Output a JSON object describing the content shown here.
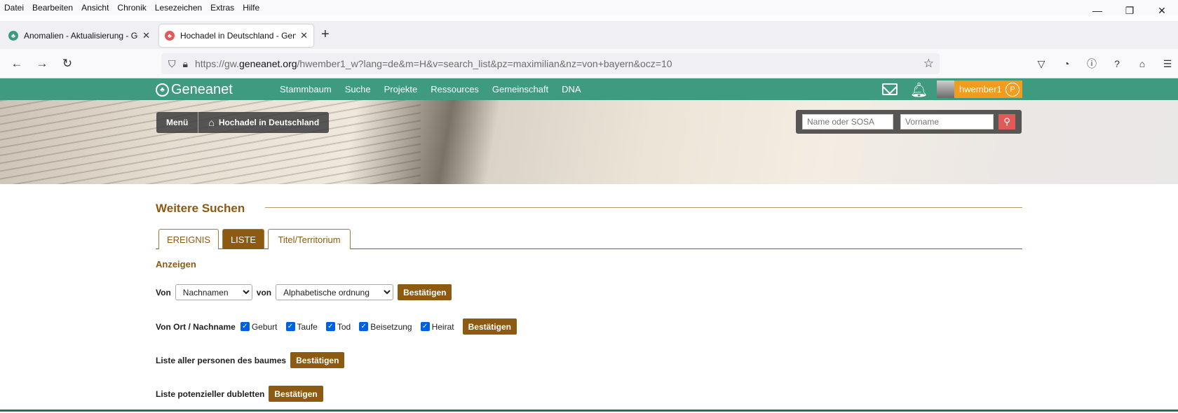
{
  "menubar": [
    "Datei",
    "Bearbeiten",
    "Ansicht",
    "Chronik",
    "Lesezeichen",
    "Extras",
    "Hilfe"
  ],
  "window": {
    "minimize": "—",
    "restore": "❐",
    "close": "✕"
  },
  "tabs": [
    {
      "title": "Anomalien - Aktualisierung - Gen",
      "active": false
    },
    {
      "title": "Hochadel in Deutschland - Gene",
      "active": true
    }
  ],
  "newtab": "+",
  "url": {
    "scheme": "https://gw.",
    "host": "geneanet.org",
    "path": "/hwember1_w?lang=de&m=H&v=search_list&pz=maximilian&nz=von+bayern&ocz=10"
  },
  "site": {
    "logo": "Geneanet",
    "nav": [
      "Stammbaum",
      "Suche",
      "Projekte",
      "Ressources",
      "Gemeinschaft",
      "DNA"
    ],
    "user": "hwember1",
    "premium_badge": "P",
    "breadcrumb": {
      "menu": "Menü",
      "home": "Hochadel in Deutschland"
    },
    "search": {
      "name_placeholder": "Name oder SOSA",
      "firstname_placeholder": "Vorname"
    }
  },
  "content": {
    "heading": "Weitere Suchen",
    "tabs": [
      "EREIGNIS",
      "LISTE",
      "Titel/Territorium"
    ],
    "selected_tab": "LISTE",
    "subheading": "Anzeigen",
    "row1": {
      "von1": "Von",
      "select1": "Nachnamen",
      "von2": "von",
      "select2": "Alphabetische ordnung",
      "button": "Bestätigen"
    },
    "row2": {
      "label": "Von Ort / Nachname",
      "checks": [
        "Geburt",
        "Taufe",
        "Tod",
        "Beisetzung",
        "Heirat"
      ],
      "button": "Bestätigen"
    },
    "row3": {
      "label": "Liste aller personen des baumes",
      "button": "Bestätigen"
    },
    "row4": {
      "label": "Liste potenzieller dubletten",
      "button": "Bestätigen"
    }
  },
  "colors": {
    "green": "#3f9b80",
    "brown": "#8c5a10",
    "orange": "#f29c1f"
  }
}
